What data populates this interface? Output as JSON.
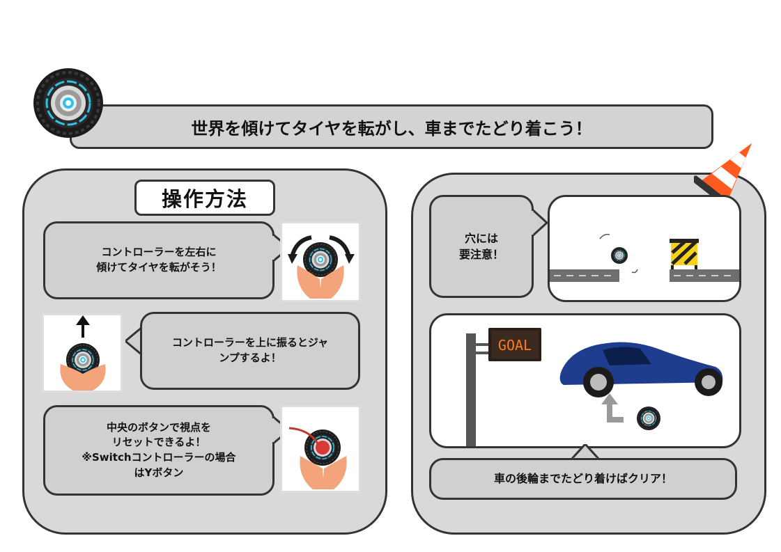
{
  "title": "世界を傾けてタイヤを転がし、車までたどり着こう！",
  "controls": {
    "heading": "操作方法",
    "tilt_text": [
      "コントローラーを左右に",
      "傾けてタイヤを転がそう！"
    ],
    "jump_text": [
      "コントローラーを上に振るとジャ",
      "ンプするよ！"
    ],
    "reset_text": [
      "中央のボタンで視点を",
      "リセットできるよ！",
      "※Switchコントローラーの場合",
      "はYボタン"
    ]
  },
  "tips": {
    "hole_text": [
      "穴には",
      "要注意！"
    ],
    "goal_sign": "GOAL",
    "clear_text": "車の後輪までたどり着けばクリア！"
  },
  "colors": {
    "panel": "#d9d9d9",
    "border": "#333333",
    "tire_accent": "#2ec4e8",
    "cone_orange": "#ff5a1f",
    "goal_sign": "#ff7a20",
    "car_blue": "#1e3d8f"
  },
  "icons": [
    "tire-logo-icon",
    "traffic-cone-icon",
    "hands-controller-icon",
    "barrier-icon",
    "goal-sign-icon",
    "sports-car-icon",
    "arrow-up-icon"
  ]
}
